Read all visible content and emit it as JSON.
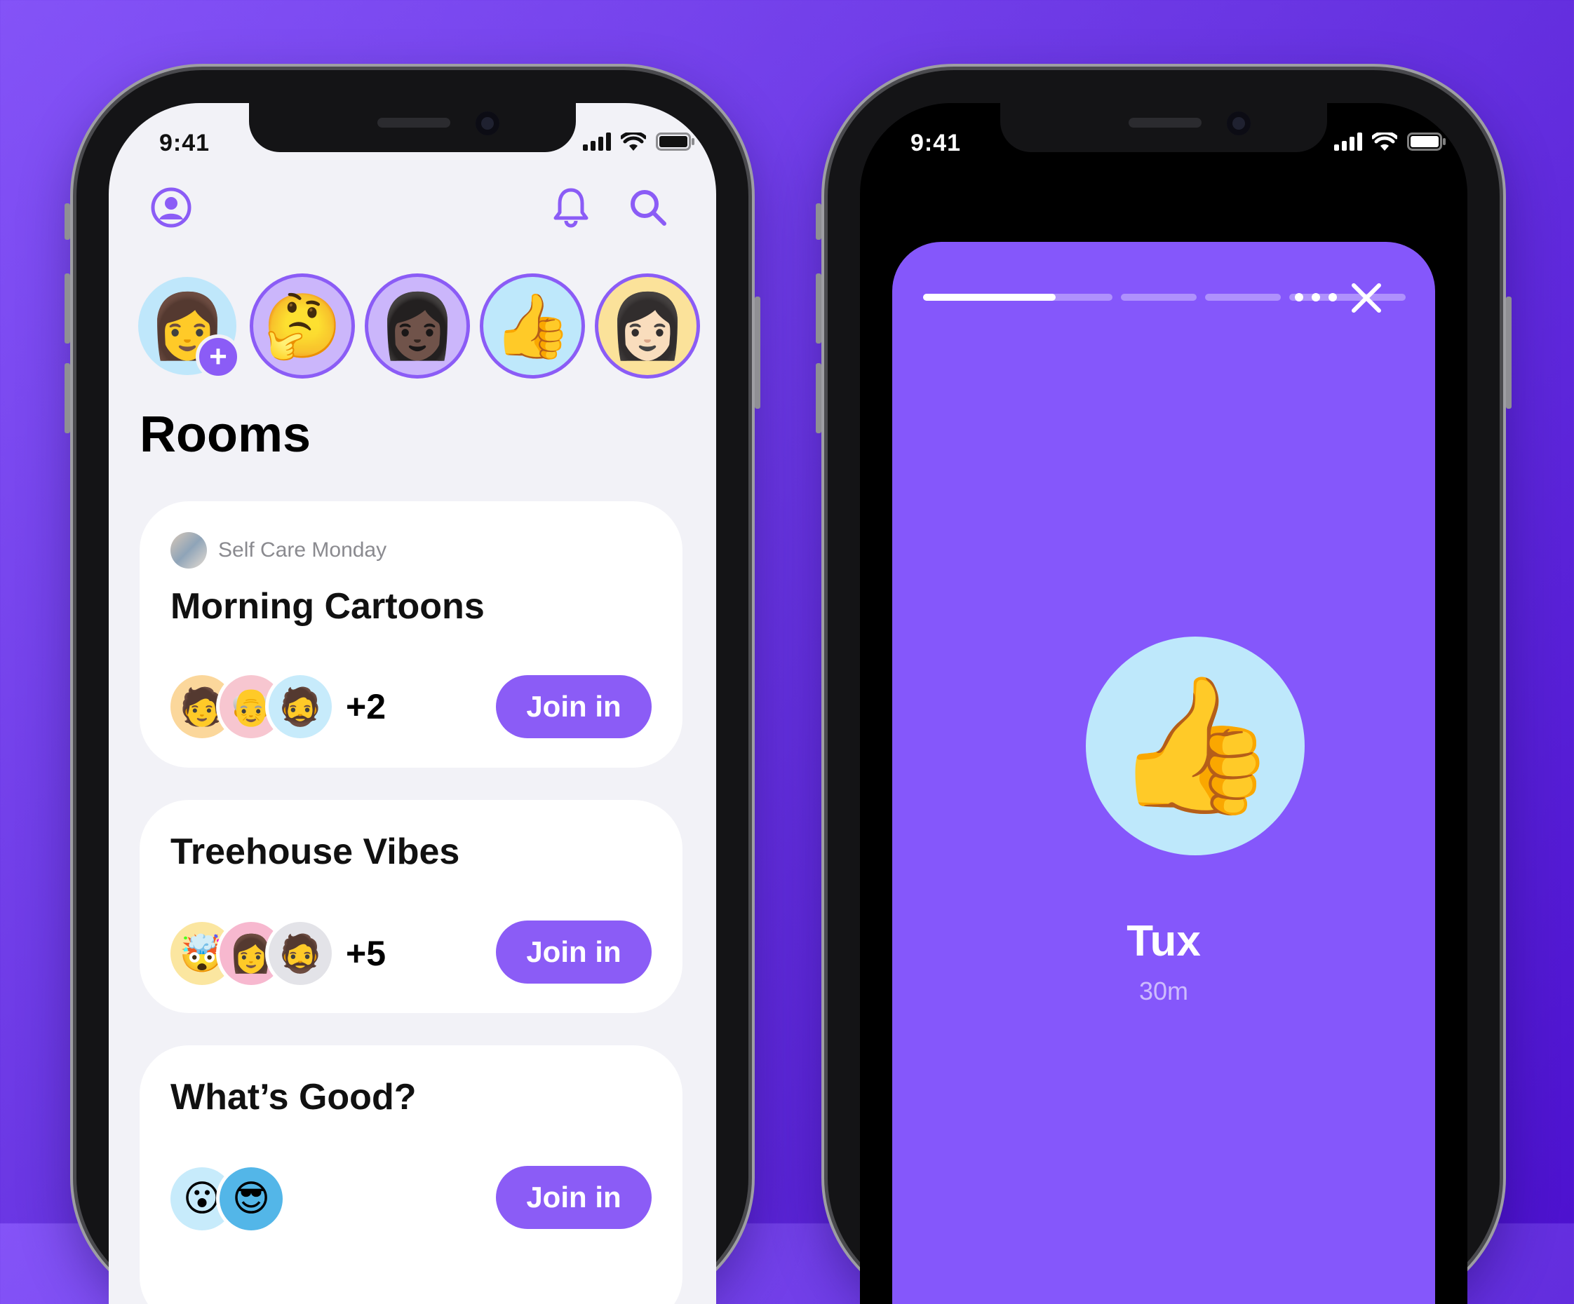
{
  "colors": {
    "background_start": "#8453f7",
    "background_end": "#4d12cf",
    "accent": "#8b5cf6",
    "story_background": "#8557fb"
  },
  "left_phone": {
    "status_bar": {
      "time": "9:41",
      "icons": [
        "signal-icon",
        "wifi-icon",
        "battery-icon"
      ]
    },
    "top_bar": {
      "left_icon": "profile-icon",
      "right_icons": [
        "bell-icon",
        "search-icon"
      ]
    },
    "stories": [
      {
        "avatar": "woman-brown-hair-memoji",
        "emoji": "👩",
        "ring": false,
        "add_badge": true
      },
      {
        "avatar": "man-green-hair-memoji",
        "emoji": "🤔",
        "ring": true
      },
      {
        "avatar": "woman-braids-memoji",
        "emoji": "👩🏿",
        "ring": true
      },
      {
        "avatar": "man-pink-hair-thumbs-up-memoji",
        "emoji": "👍",
        "ring": true
      },
      {
        "avatar": "woman-dark-hair-memoji",
        "emoji": "👩🏻",
        "ring": true
      }
    ],
    "rooms_title": "Rooms",
    "rooms": [
      {
        "club": "Self Care Monday",
        "title": "Morning Cartoons",
        "participants": [
          {
            "emoji": "🧑",
            "bg": "#fbd79b"
          },
          {
            "emoji": "👴",
            "bg": "#f7c6d0"
          },
          {
            "emoji": "🧔",
            "bg": "#c7ebfb"
          }
        ],
        "more_count": "+2",
        "join_label": "Join in"
      },
      {
        "club": "",
        "title": "Treehouse Vibes",
        "participants": [
          {
            "emoji": "🤯",
            "bg": "#fbe6a0"
          },
          {
            "emoji": "👩",
            "bg": "#f7b8cf"
          },
          {
            "emoji": "🧔",
            "bg": "#e3e3e8"
          }
        ],
        "more_count": "+5",
        "join_label": "Join in"
      },
      {
        "club": "",
        "title": "What’s Good?",
        "participants": [
          {
            "emoji": "😮",
            "bg": "#c7ebfb"
          },
          {
            "emoji": "😎",
            "bg": "#53b6e8"
          }
        ],
        "more_count": "",
        "join_label": "Join in"
      }
    ]
  },
  "right_phone": {
    "status_bar": {
      "time": "9:41",
      "icons": [
        "signal-icon",
        "wifi-icon",
        "battery-icon"
      ]
    },
    "story_progress": {
      "segments": 4,
      "active_segment_fraction": 0.7
    },
    "controls": [
      "more-icon",
      "close-icon"
    ],
    "host": {
      "avatar": "man-pink-hair-thumbs-up-memoji",
      "emoji": "👍",
      "name": "Tux",
      "time_ago": "30m"
    }
  }
}
